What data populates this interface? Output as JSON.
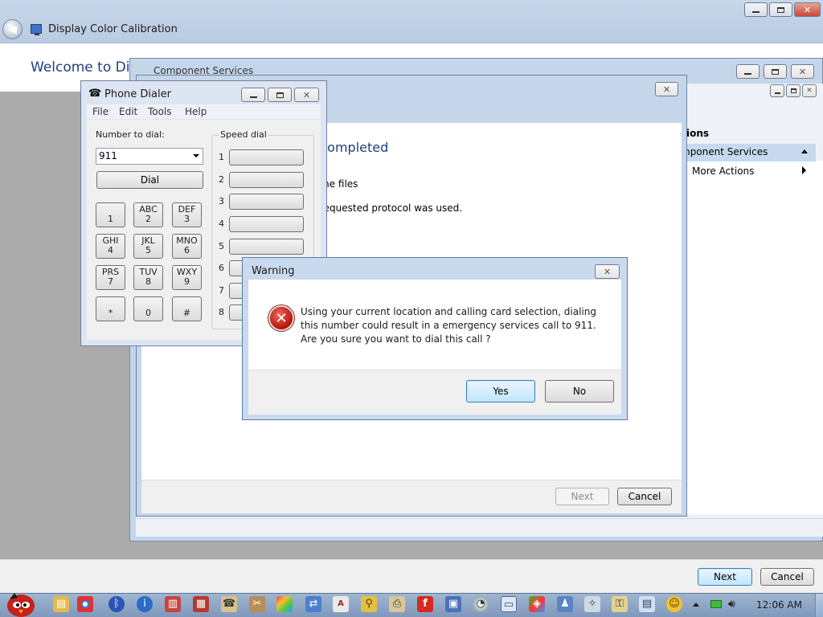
{
  "main_window": {
    "title": "Display Color Calibration",
    "welcome": "Welcome to Disp",
    "next_label": "Next",
    "cancel_label": "Cancel"
  },
  "component_services": {
    "title": "Component Services",
    "actions_header": "ions",
    "selected_action": "mponent Services",
    "more_actions": "More Actions"
  },
  "wizard": {
    "heading": "t completed",
    "line1": "me files",
    "line2": "requested protocol was used.",
    "next_label": "Next",
    "cancel_label": "Cancel"
  },
  "phone_dialer": {
    "title": "Phone Dialer",
    "menu": [
      "File",
      "Edit",
      "Tools",
      "Help"
    ],
    "number_label": "Number to dial:",
    "number_value": "911",
    "dial_label": "Dial",
    "speed_dial_label": "Speed dial",
    "keys": [
      {
        "letters": "",
        "digit": "1"
      },
      {
        "letters": "ABC",
        "digit": "2"
      },
      {
        "letters": "DEF",
        "digit": "3"
      },
      {
        "letters": "GHI",
        "digit": "4"
      },
      {
        "letters": "JKL",
        "digit": "5"
      },
      {
        "letters": "MNO",
        "digit": "6"
      },
      {
        "letters": "PRS",
        "digit": "7"
      },
      {
        "letters": "TUV",
        "digit": "8"
      },
      {
        "letters": "WXY",
        "digit": "9"
      },
      {
        "letters": "",
        "digit": "*"
      },
      {
        "letters": "",
        "digit": "0"
      },
      {
        "letters": "",
        "digit": "#"
      }
    ],
    "speed_dial_numbers": [
      "1",
      "2",
      "3",
      "4",
      "5",
      "6",
      "7",
      "8"
    ]
  },
  "warning": {
    "title": "Warning",
    "message_lines": [
      "Using your current location and calling card selection, dialing",
      "this number could result in a emergency services call to 911.",
      "Are you sure you want to dial this call ?"
    ],
    "yes_label": "Yes",
    "no_label": "No",
    "close_glyph": "✕"
  },
  "taskbar": {
    "clock": "12:06 AM"
  }
}
